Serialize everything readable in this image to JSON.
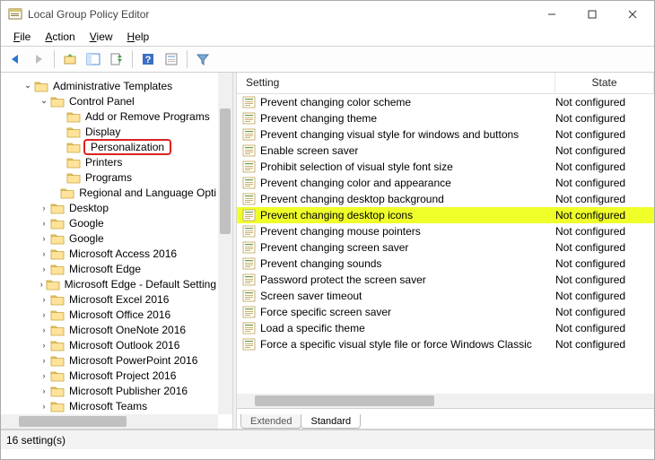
{
  "window": {
    "title": "Local Group Policy Editor"
  },
  "menu": {
    "file": "File",
    "action": "Action",
    "view": "View",
    "help": "Help"
  },
  "tree": {
    "items": [
      {
        "depth": 0,
        "label": "Administrative Templates",
        "expander": "▾"
      },
      {
        "depth": 1,
        "label": "Control Panel",
        "expander": "▾"
      },
      {
        "depth": 2,
        "label": "Add or Remove Programs",
        "expander": ""
      },
      {
        "depth": 2,
        "label": "Display",
        "expander": ""
      },
      {
        "depth": 2,
        "label": "Personalization",
        "expander": "",
        "highlighted": true
      },
      {
        "depth": 2,
        "label": "Printers",
        "expander": ""
      },
      {
        "depth": 2,
        "label": "Programs",
        "expander": ""
      },
      {
        "depth": 2,
        "label": "Regional and Language Opti",
        "expander": ""
      },
      {
        "depth": 1,
        "label": "Desktop",
        "expander": "▸"
      },
      {
        "depth": 1,
        "label": "Google",
        "expander": "▸"
      },
      {
        "depth": 1,
        "label": "Google",
        "expander": "▸"
      },
      {
        "depth": 1,
        "label": "Microsoft Access 2016",
        "expander": "▸"
      },
      {
        "depth": 1,
        "label": "Microsoft Edge",
        "expander": "▸"
      },
      {
        "depth": 1,
        "label": "Microsoft Edge - Default Setting",
        "expander": "▸"
      },
      {
        "depth": 1,
        "label": "Microsoft Excel 2016",
        "expander": "▸"
      },
      {
        "depth": 1,
        "label": "Microsoft Office 2016",
        "expander": "▸"
      },
      {
        "depth": 1,
        "label": "Microsoft OneNote 2016",
        "expander": "▸"
      },
      {
        "depth": 1,
        "label": "Microsoft Outlook 2016",
        "expander": "▸"
      },
      {
        "depth": 1,
        "label": "Microsoft PowerPoint 2016",
        "expander": "▸"
      },
      {
        "depth": 1,
        "label": "Microsoft Project 2016",
        "expander": "▸"
      },
      {
        "depth": 1,
        "label": "Microsoft Publisher 2016",
        "expander": "▸"
      },
      {
        "depth": 1,
        "label": "Microsoft Teams",
        "expander": "▸"
      }
    ]
  },
  "list": {
    "header": {
      "setting": "Setting",
      "state": "State"
    },
    "rows": [
      {
        "setting": "Prevent changing color scheme",
        "state": "Not configured"
      },
      {
        "setting": "Prevent changing theme",
        "state": "Not configured"
      },
      {
        "setting": "Prevent changing visual style for windows and buttons",
        "state": "Not configured"
      },
      {
        "setting": "Enable screen saver",
        "state": "Not configured"
      },
      {
        "setting": "Prohibit selection of visual style font size",
        "state": "Not configured"
      },
      {
        "setting": "Prevent changing color and appearance",
        "state": "Not configured"
      },
      {
        "setting": "Prevent changing desktop background",
        "state": "Not configured"
      },
      {
        "setting": "Prevent changing desktop icons",
        "state": "Not configured",
        "highlighted": true
      },
      {
        "setting": "Prevent changing mouse pointers",
        "state": "Not configured"
      },
      {
        "setting": "Prevent changing screen saver",
        "state": "Not configured"
      },
      {
        "setting": "Prevent changing sounds",
        "state": "Not configured"
      },
      {
        "setting": "Password protect the screen saver",
        "state": "Not configured"
      },
      {
        "setting": "Screen saver timeout",
        "state": "Not configured"
      },
      {
        "setting": "Force specific screen saver",
        "state": "Not configured"
      },
      {
        "setting": "Load a specific theme",
        "state": "Not configured"
      },
      {
        "setting": "Force a specific visual style file or force Windows Classic",
        "state": "Not configured"
      }
    ]
  },
  "tabs": {
    "extended": "Extended",
    "standard": "Standard"
  },
  "status": {
    "text": "16 setting(s)"
  }
}
